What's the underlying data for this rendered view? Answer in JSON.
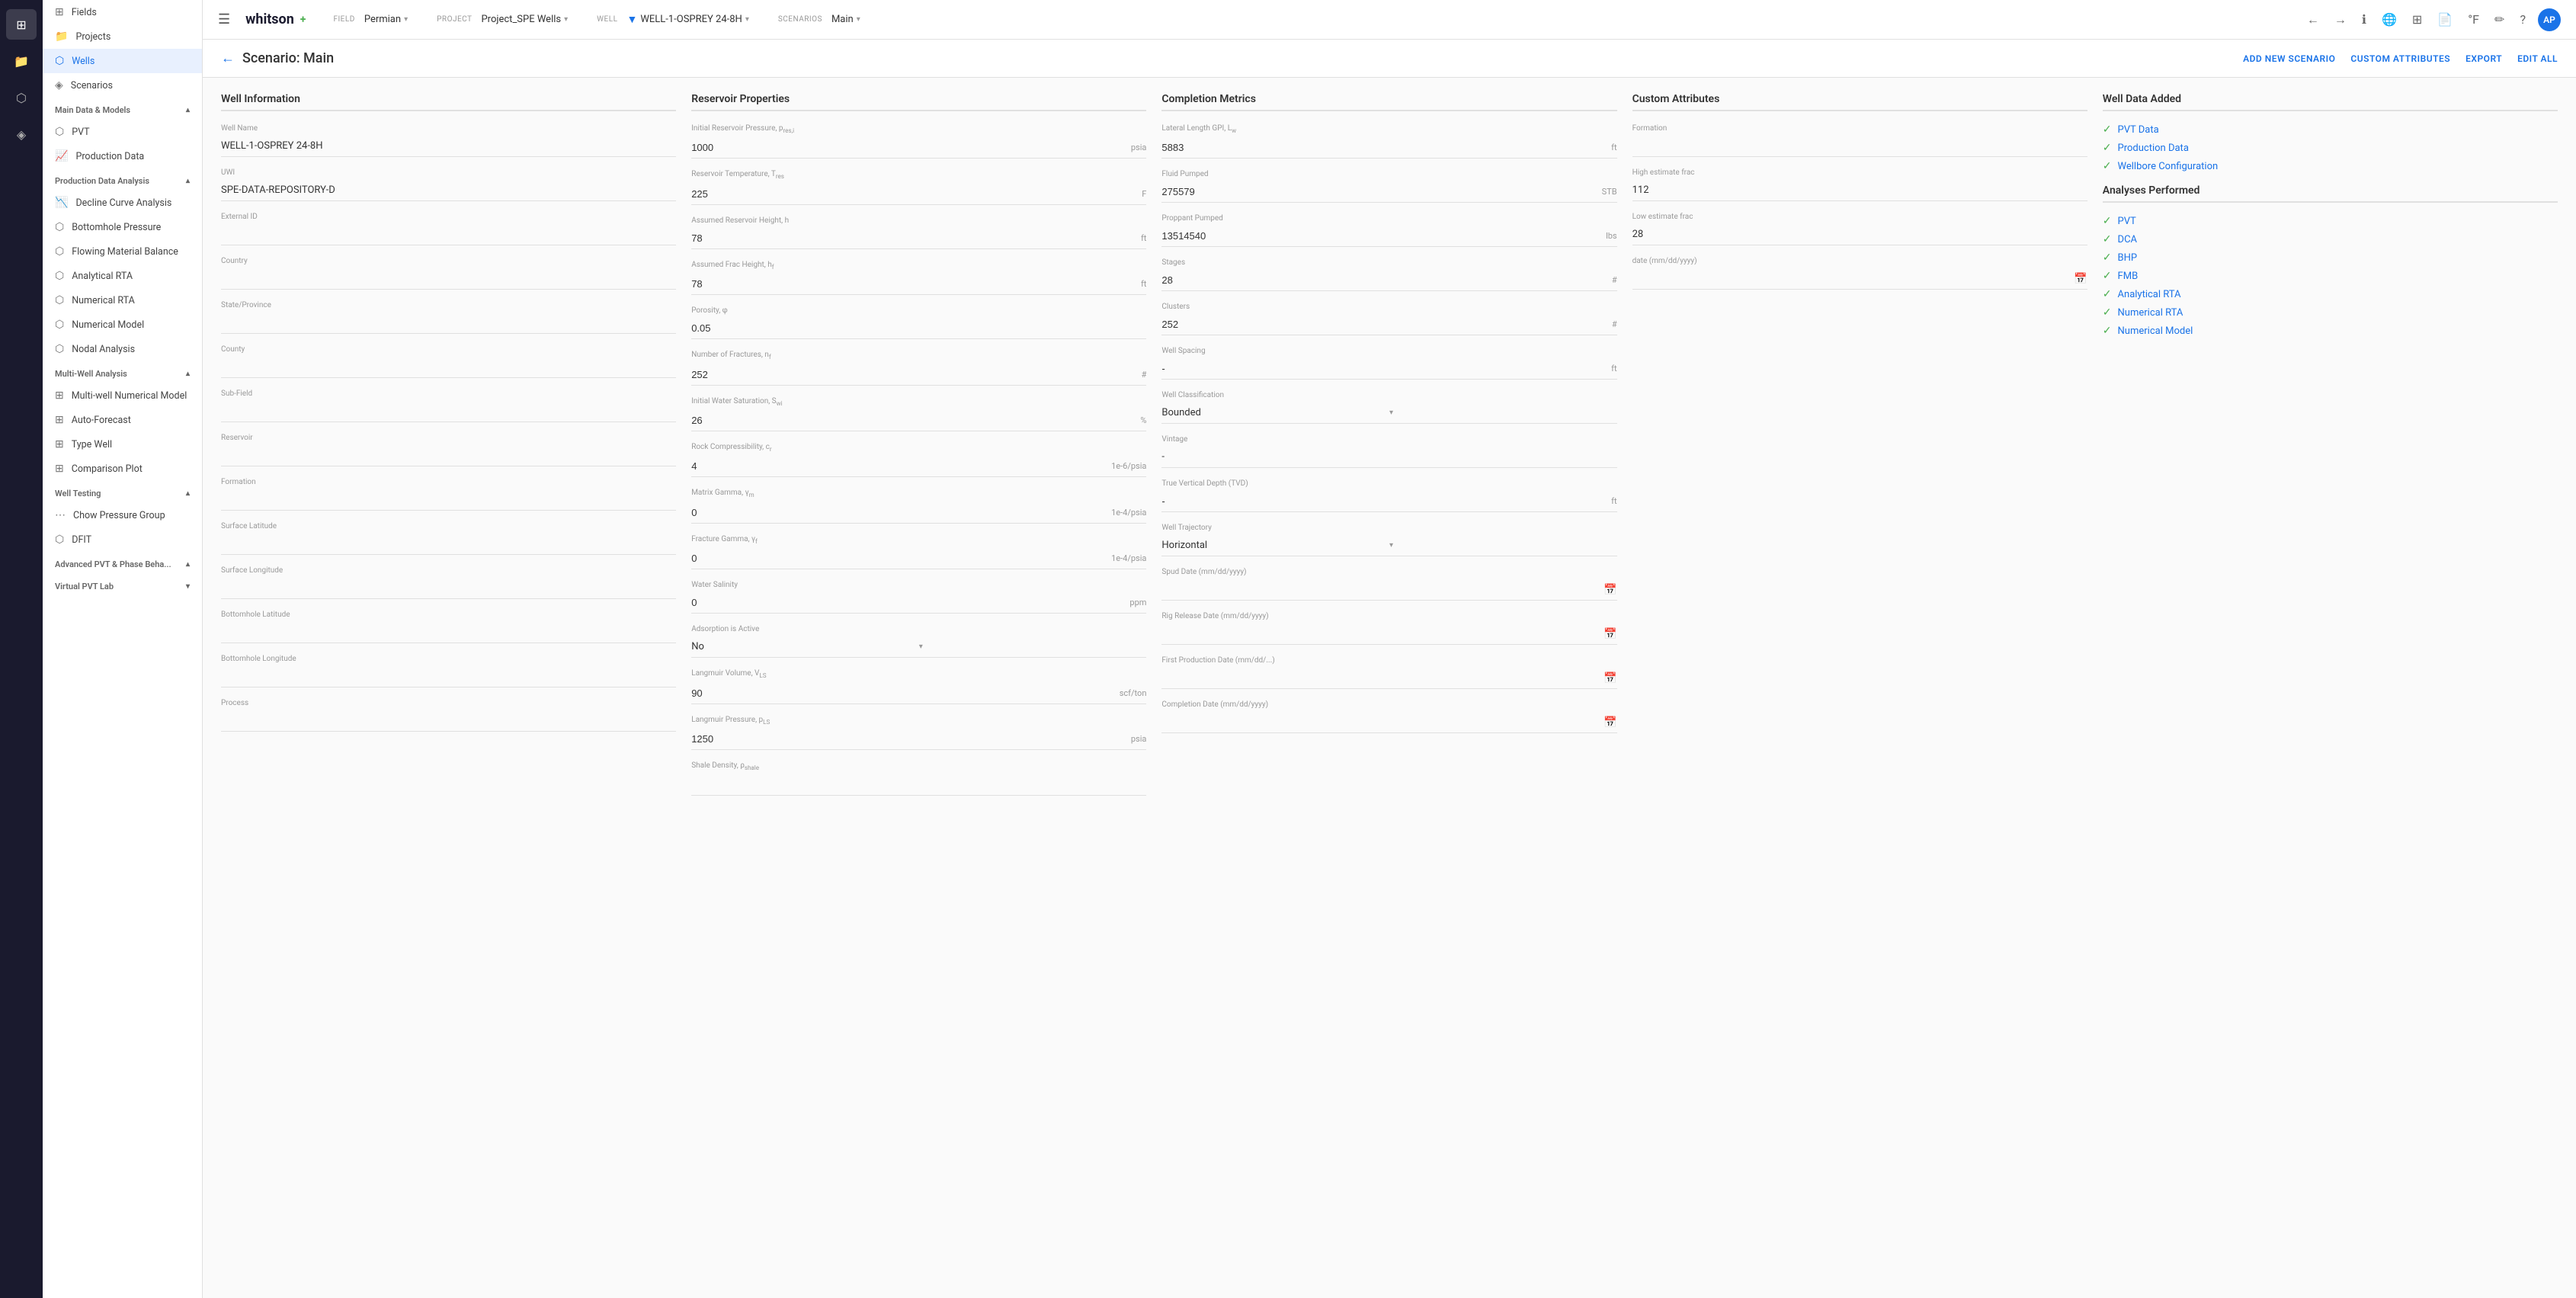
{
  "app": {
    "name": "whitson",
    "plus": "+",
    "hamburger": "☰"
  },
  "topbar": {
    "field_label": "Field",
    "field_value": "Permian",
    "project_label": "Project",
    "project_value": "Project_SPE Wells",
    "well_label": "Well",
    "well_value": "WELL-1-OSPREY 24-8H",
    "scenario_label": "Scenarios",
    "scenario_value": "Main"
  },
  "page": {
    "back": "←",
    "title": "Scenario: Main",
    "action_add": "ADD NEW SCENARIO",
    "action_custom": "CUSTOM ATTRIBUTES",
    "action_export": "EXPORT",
    "action_edit": "EDIT ALL"
  },
  "nav": {
    "items": [
      {
        "id": "fields",
        "label": "Fields",
        "icon": "⊞"
      },
      {
        "id": "projects",
        "label": "Projects",
        "icon": "📁"
      },
      {
        "id": "wells",
        "label": "Wells",
        "icon": "⬡",
        "active": true
      },
      {
        "id": "scenarios",
        "label": "Scenarios",
        "icon": "◈"
      }
    ],
    "sections": [
      {
        "id": "main-data-models",
        "label": "Main Data & Models",
        "collapsed": false,
        "items": [
          {
            "id": "pvt",
            "label": "PVT",
            "icon": "⬡"
          },
          {
            "id": "production-data",
            "label": "Production Data",
            "icon": "📈"
          }
        ]
      },
      {
        "id": "production-data-analysis",
        "label": "Production Data Analysis",
        "collapsed": false,
        "items": [
          {
            "id": "decline-curve",
            "label": "Decline Curve Analysis",
            "icon": "📉"
          },
          {
            "id": "bottomhole",
            "label": "Bottomhole Pressure",
            "icon": "⬡"
          },
          {
            "id": "flowing-mb",
            "label": "Flowing Material Balance",
            "icon": "⬡"
          },
          {
            "id": "analytical-rta",
            "label": "Analytical RTA",
            "icon": "⬡"
          },
          {
            "id": "numerical-rta",
            "label": "Numerical RTA",
            "icon": "⬡"
          },
          {
            "id": "numerical-model",
            "label": "Numerical Model",
            "icon": "⬡"
          },
          {
            "id": "nodal-analysis",
            "label": "Nodal Analysis",
            "icon": "⬡"
          }
        ]
      },
      {
        "id": "multi-well",
        "label": "Multi-Well Analysis",
        "collapsed": false,
        "items": [
          {
            "id": "multi-well-num",
            "label": "Multi-well Numerical Model",
            "icon": "⊞"
          },
          {
            "id": "auto-forecast",
            "label": "Auto-Forecast",
            "icon": "⊞"
          },
          {
            "id": "type-well",
            "label": "Type Well",
            "icon": "⊞"
          },
          {
            "id": "comparison-plot",
            "label": "Comparison Plot",
            "icon": "⊞"
          }
        ]
      },
      {
        "id": "well-testing",
        "label": "Well Testing",
        "collapsed": false,
        "items": [
          {
            "id": "chow-pressure",
            "label": "Chow Pressure Group",
            "icon": "⋯"
          },
          {
            "id": "dfit",
            "label": "DFIT",
            "icon": "⬡"
          }
        ]
      },
      {
        "id": "advanced-pvt",
        "label": "Advanced PVT & Phase Beha...",
        "collapsed": false,
        "items": []
      },
      {
        "id": "virtual-pvt",
        "label": "Virtual PVT Lab",
        "collapsed": true,
        "items": []
      }
    ]
  },
  "well_info": {
    "section_title": "Well Information",
    "fields": [
      {
        "label": "Well Name",
        "value": "WELL-1-OSPREY 24-8H",
        "type": "text"
      },
      {
        "label": "UWI",
        "value": "SPE-DATA-REPOSITORY-D",
        "type": "text"
      },
      {
        "label": "External ID",
        "value": "",
        "type": "text"
      },
      {
        "label": "Country",
        "value": "",
        "type": "text"
      },
      {
        "label": "State/Province",
        "value": "",
        "type": "text"
      },
      {
        "label": "County",
        "value": "",
        "type": "text"
      },
      {
        "label": "Sub-Field",
        "value": "",
        "type": "text"
      },
      {
        "label": "Reservoir",
        "value": "",
        "type": "text"
      },
      {
        "label": "Formation",
        "value": "",
        "type": "text"
      },
      {
        "label": "Surface Latitude",
        "value": "",
        "type": "text"
      },
      {
        "label": "Surface Longitude",
        "value": "",
        "type": "text"
      },
      {
        "label": "Bottomhole Latitude",
        "value": "",
        "type": "text"
      },
      {
        "label": "Bottomhole Longitude",
        "value": "",
        "type": "text"
      },
      {
        "label": "Process",
        "value": "",
        "type": "text"
      }
    ]
  },
  "reservoir": {
    "section_title": "Reservoir Properties",
    "fields": [
      {
        "label": "Initial Reservoir Pressure, p_res,i",
        "value": "1000",
        "unit": "psia",
        "type": "input"
      },
      {
        "label": "Reservoir Temperature, T_res",
        "value": "225",
        "unit": "F",
        "type": "input"
      },
      {
        "label": "Assumed Reservoir Height, h",
        "value": "78",
        "unit": "ft",
        "type": "input"
      },
      {
        "label": "Assumed Frac Height, h_f",
        "value": "78",
        "unit": "ft",
        "type": "input"
      },
      {
        "label": "Porosity, φ",
        "value": "0.05",
        "unit": "",
        "type": "input"
      },
      {
        "label": "Number of Fractures, n_f",
        "value": "252",
        "unit": "#",
        "type": "input"
      },
      {
        "label": "Initial Water Saturation, S_wi",
        "value": "26",
        "unit": "%",
        "type": "input"
      },
      {
        "label": "Rock Compressibility, c_r",
        "value": "4",
        "unit": "1e-6/psia",
        "type": "input"
      },
      {
        "label": "Matrix Gamma, γ_m",
        "value": "0",
        "unit": "1e-4/psia",
        "type": "input"
      },
      {
        "label": "Fracture Gamma, γ_f",
        "value": "0",
        "unit": "1e-4/psia",
        "type": "input"
      },
      {
        "label": "Water Salinity",
        "value": "0",
        "unit": "ppm",
        "type": "input"
      },
      {
        "label": "Adsorption is Active",
        "value": "No",
        "unit": "",
        "type": "dropdown"
      },
      {
        "label": "Langmuir Volume, V_LS",
        "value": "90",
        "unit": "scf/ton",
        "type": "input"
      },
      {
        "label": "Langmuir Pressure, p_LS",
        "value": "1250",
        "unit": "psia",
        "type": "input"
      },
      {
        "label": "Shale Density, ρ_shale",
        "value": "",
        "unit": "",
        "type": "input"
      }
    ]
  },
  "completion": {
    "section_title": "Completion Metrics",
    "fields": [
      {
        "label": "Lateral Length GPI, L_w",
        "value": "5883",
        "unit": "ft",
        "type": "input"
      },
      {
        "label": "Fluid Pumped",
        "value": "275579",
        "unit": "STB",
        "type": "input"
      },
      {
        "label": "Proppant Pumped",
        "value": "13514540",
        "unit": "lbs",
        "type": "input"
      },
      {
        "label": "Stages",
        "value": "28",
        "unit": "#",
        "type": "input"
      },
      {
        "label": "Clusters",
        "value": "252",
        "unit": "#",
        "type": "input"
      },
      {
        "label": "Well Spacing",
        "value": "-",
        "unit": "ft",
        "type": "input"
      },
      {
        "label": "Well Classification",
        "value": "Bounded",
        "unit": "",
        "type": "dropdown"
      },
      {
        "label": "Vintage",
        "value": "-",
        "unit": "",
        "type": "text"
      },
      {
        "label": "True Vertical Depth (TVD)",
        "value": "-",
        "unit": "ft",
        "type": "input"
      },
      {
        "label": "Well Trajectory",
        "value": "Horizontal",
        "unit": "",
        "type": "dropdown"
      },
      {
        "label": "Spud Date (mm/dd/yyyy)",
        "value": "",
        "unit": "",
        "type": "date"
      },
      {
        "label": "Rig Release Date (mm/dd/yyyy)",
        "value": "",
        "unit": "",
        "type": "date"
      },
      {
        "label": "First Production Date (mm/dd/...)",
        "value": "",
        "unit": "",
        "type": "date"
      },
      {
        "label": "Completion Date (mm/dd/yyyy)",
        "value": "",
        "unit": "",
        "type": "date"
      }
    ]
  },
  "custom_attributes": {
    "section_title": "Custom Attributes",
    "fields": [
      {
        "label": "Formation",
        "value": "",
        "type": "text"
      },
      {
        "label": "High estimate frac",
        "value": "112",
        "type": "text"
      },
      {
        "label": "Low estimate frac",
        "value": "28",
        "type": "text"
      },
      {
        "label": "date (mm/dd/yyyy)",
        "value": "",
        "type": "date"
      }
    ]
  },
  "well_data_added": {
    "section_title": "Well Data Added",
    "checks": [
      {
        "label": "PVT Data",
        "checked": true
      },
      {
        "label": "Production Data",
        "checked": true
      },
      {
        "label": "Wellbore Configuration",
        "checked": true
      }
    ],
    "analyses_title": "Analyses Performed",
    "analyses": [
      {
        "label": "PVT",
        "checked": true
      },
      {
        "label": "DCA",
        "checked": true
      },
      {
        "label": "BHP",
        "checked": true
      },
      {
        "label": "FMB",
        "checked": true
      },
      {
        "label": "Analytical RTA",
        "checked": true
      },
      {
        "label": "Numerical RTA",
        "checked": true
      },
      {
        "label": "Numerical Model",
        "checked": true
      }
    ]
  },
  "icons": {
    "check": "✓",
    "chevron_down": "▾",
    "chevron_up": "▴",
    "calendar": "📅",
    "dropdown_arrow": "▾",
    "back_arrow": "←",
    "nav_back": "←",
    "nav_fwd": "→",
    "info": "ℹ",
    "globe": "🌐",
    "grid": "⊞",
    "doc": "📄",
    "temp": "°F",
    "pencil": "✏",
    "help": "?"
  }
}
